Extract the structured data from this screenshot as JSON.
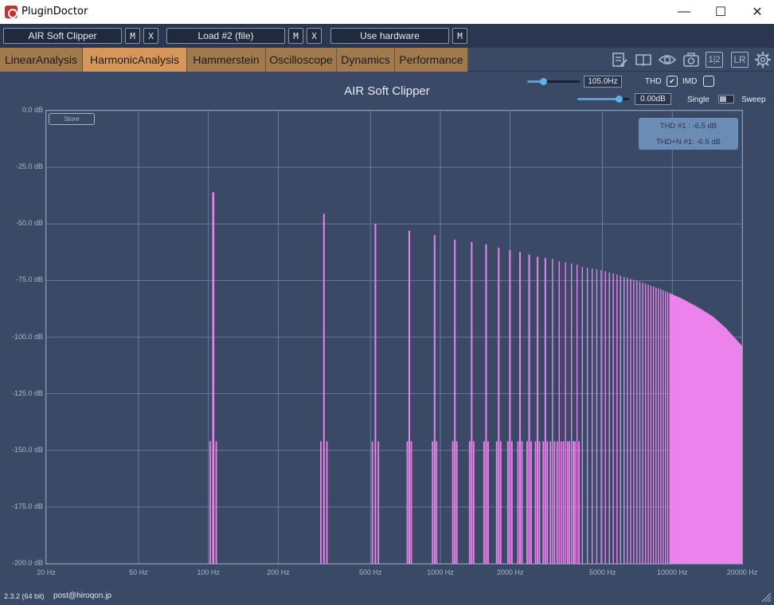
{
  "window": {
    "title": "PluginDoctor",
    "minimize": "—",
    "maximize": "☐",
    "close": "✕"
  },
  "slots": {
    "plugin": "AIR Soft Clipper",
    "load": "Load #2 (file)",
    "hardware": "Use hardware",
    "m_label": "M",
    "x_label": "X"
  },
  "tabs": [
    "LinearAnalysis",
    "HarmonicAnalysis",
    "Hammerstein",
    "Oscilloscope",
    "Dynamics",
    "Performance"
  ],
  "active_tab": "HarmonicAnalysis",
  "toolbar_icons": [
    "notes-icon",
    "book-icon",
    "eye-icon",
    "camera-icon",
    "channel-split-icon",
    "lr-icon",
    "gear-icon"
  ],
  "toolbar_glyphs": {
    "channel": "1|2",
    "lr": "LR"
  },
  "controls": {
    "frequency": "105.0Hz",
    "frequency_fraction": 0.3,
    "level": "0.00dB",
    "level_fraction": 0.8,
    "thd_label": "THD",
    "imd_label": "IMD",
    "thd_checked": true,
    "imd_checked": false,
    "single_label": "Single",
    "sweep_label": "Sweep"
  },
  "store_label": "Store",
  "thd_readout": {
    "thd": "THD #1 : -6.5 dB",
    "thdn": "THD+N #1: -6.5 dB"
  },
  "footer": {
    "version": "2.3.2 (64 bit)",
    "email": "post@hiroqon.jp"
  },
  "colors": {
    "background": "#3a4a66",
    "spectrum": "#ec82ec",
    "tab": "#a07a4c",
    "tab_active": "#d6975a",
    "grid": "#6f86a8"
  },
  "chart_data": {
    "type": "bar",
    "title": "AIR Soft Clipper",
    "x_scale": "log",
    "xlim": [
      20,
      20000
    ],
    "ylim": [
      -200,
      0
    ],
    "x_ticks": [
      "20 Hz",
      "50 Hz",
      "100 Hz",
      "200 Hz",
      "500 Hz",
      "1000 Hz",
      "2000 Hz",
      "5000 Hz",
      "10000 Hz",
      "20000 Hz"
    ],
    "x_tick_values": [
      20,
      50,
      100,
      200,
      500,
      1000,
      2000,
      5000,
      10000,
      20000
    ],
    "y_ticks": [
      "0.0 dB",
      "-25.0 dB",
      "-50.0 dB",
      "-75.0 dB",
      "-100.0 dB",
      "-125.0 dB",
      "-150.0 dB",
      "-175.0 dB",
      "-200.0 dB"
    ],
    "y_tick_values": [
      0,
      -25,
      -50,
      -75,
      -100,
      -125,
      -150,
      -175,
      -200
    ],
    "fundamental_hz": 105,
    "harmonic_peaks": [
      {
        "freq": 105,
        "db": -36
      },
      {
        "freq": 315,
        "db": -45.5
      },
      {
        "freq": 525,
        "db": -50
      },
      {
        "freq": 735,
        "db": -53
      },
      {
        "freq": 945,
        "db": -55
      },
      {
        "freq": 1155,
        "db": -57
      },
      {
        "freq": 1365,
        "db": -58
      },
      {
        "freq": 1575,
        "db": -59
      },
      {
        "freq": 1785,
        "db": -60.5
      },
      {
        "freq": 1995,
        "db": -61.5
      },
      {
        "freq": 2205,
        "db": -62.5
      },
      {
        "freq": 2415,
        "db": -63.5
      },
      {
        "freq": 2625,
        "db": -64.5
      },
      {
        "freq": 2835,
        "db": -65
      },
      {
        "freq": 3045,
        "db": -65.5
      },
      {
        "freq": 3255,
        "db": -66.5
      },
      {
        "freq": 3465,
        "db": -67
      },
      {
        "freq": 3675,
        "db": -67.5
      },
      {
        "freq": 3885,
        "db": -68
      },
      {
        "freq": 4095,
        "db": -69
      },
      {
        "freq": 5000,
        "db": -70.5
      },
      {
        "freq": 7000,
        "db": -75
      },
      {
        "freq": 9000,
        "db": -79
      },
      {
        "freq": 11000,
        "db": -83
      },
      {
        "freq": 13000,
        "db": -87
      },
      {
        "freq": 15000,
        "db": -91
      },
      {
        "freq": 17000,
        "db": -96
      },
      {
        "freq": 20000,
        "db": -104
      }
    ],
    "sideband_db": -146,
    "floor_db": -200
  }
}
